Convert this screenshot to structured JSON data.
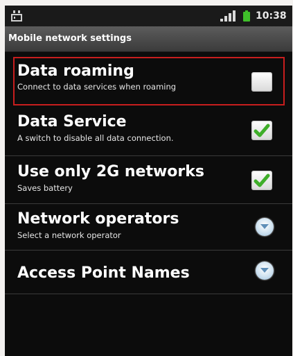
{
  "status_bar": {
    "time": "10:38",
    "icons": [
      "notification-icon",
      "signal-icon",
      "battery-icon"
    ],
    "battery_color": "#3fbf2a"
  },
  "header": {
    "title": "Mobile network settings"
  },
  "settings": [
    {
      "title": "Data roaming",
      "summary": "Connect to data services when roaming",
      "control": "checkbox",
      "checked": false,
      "highlighted": true,
      "highlight_color": "#c81e1e"
    },
    {
      "title": "Data Service",
      "summary": "A switch to disable all data connection.",
      "control": "checkbox",
      "checked": true
    },
    {
      "title": "Use only 2G networks",
      "summary": "Saves battery",
      "control": "checkbox",
      "checked": true
    },
    {
      "title": "Network operators",
      "summary": "Select a network operator",
      "control": "chevron-down-icon"
    },
    {
      "title": "Access Point Names",
      "summary": "",
      "control": "chevron-down-icon"
    }
  ],
  "colors": {
    "check_mark": "#3fae29",
    "chevron_button": "#9fc3e0"
  }
}
